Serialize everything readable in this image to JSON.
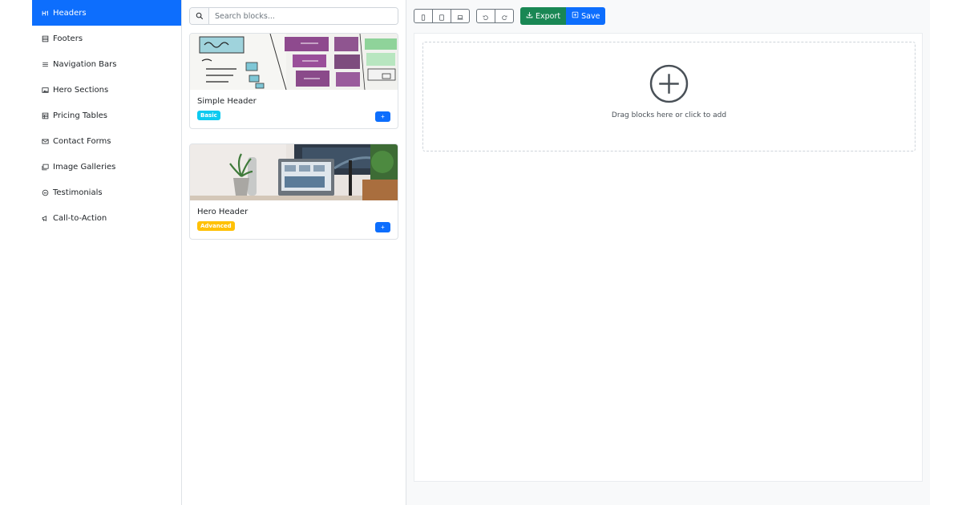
{
  "sidebar": {
    "items": [
      {
        "label": "Headers",
        "icon": "heading-icon",
        "active": true
      },
      {
        "label": "Footers",
        "icon": "layout-icon",
        "active": false
      },
      {
        "label": "Navigation Bars",
        "icon": "list-icon",
        "active": false
      },
      {
        "label": "Hero Sections",
        "icon": "image-icon",
        "active": false
      },
      {
        "label": "Pricing Tables",
        "icon": "table-icon",
        "active": false
      },
      {
        "label": "Contact Forms",
        "icon": "envelope-icon",
        "active": false
      },
      {
        "label": "Image Galleries",
        "icon": "images-icon",
        "active": false
      },
      {
        "label": "Testimonials",
        "icon": "quote-icon",
        "active": false
      },
      {
        "label": "Call-to-Action",
        "icon": "megaphone-icon",
        "active": false
      }
    ]
  },
  "search": {
    "placeholder": "Search blocks..."
  },
  "blocks": [
    {
      "title": "Simple Header",
      "badge": "Basic",
      "add_label": "+"
    },
    {
      "title": "Hero Header",
      "badge": "Advanced",
      "add_label": "+"
    }
  ],
  "toolbar": {
    "export_label": "Export",
    "save_label": "Save"
  },
  "canvas": {
    "hint": "Drag blocks here or click to add"
  },
  "colors": {
    "primary": "#0d6efd",
    "success": "#198754",
    "info": "#0dcaf0",
    "warning": "#ffc107"
  }
}
